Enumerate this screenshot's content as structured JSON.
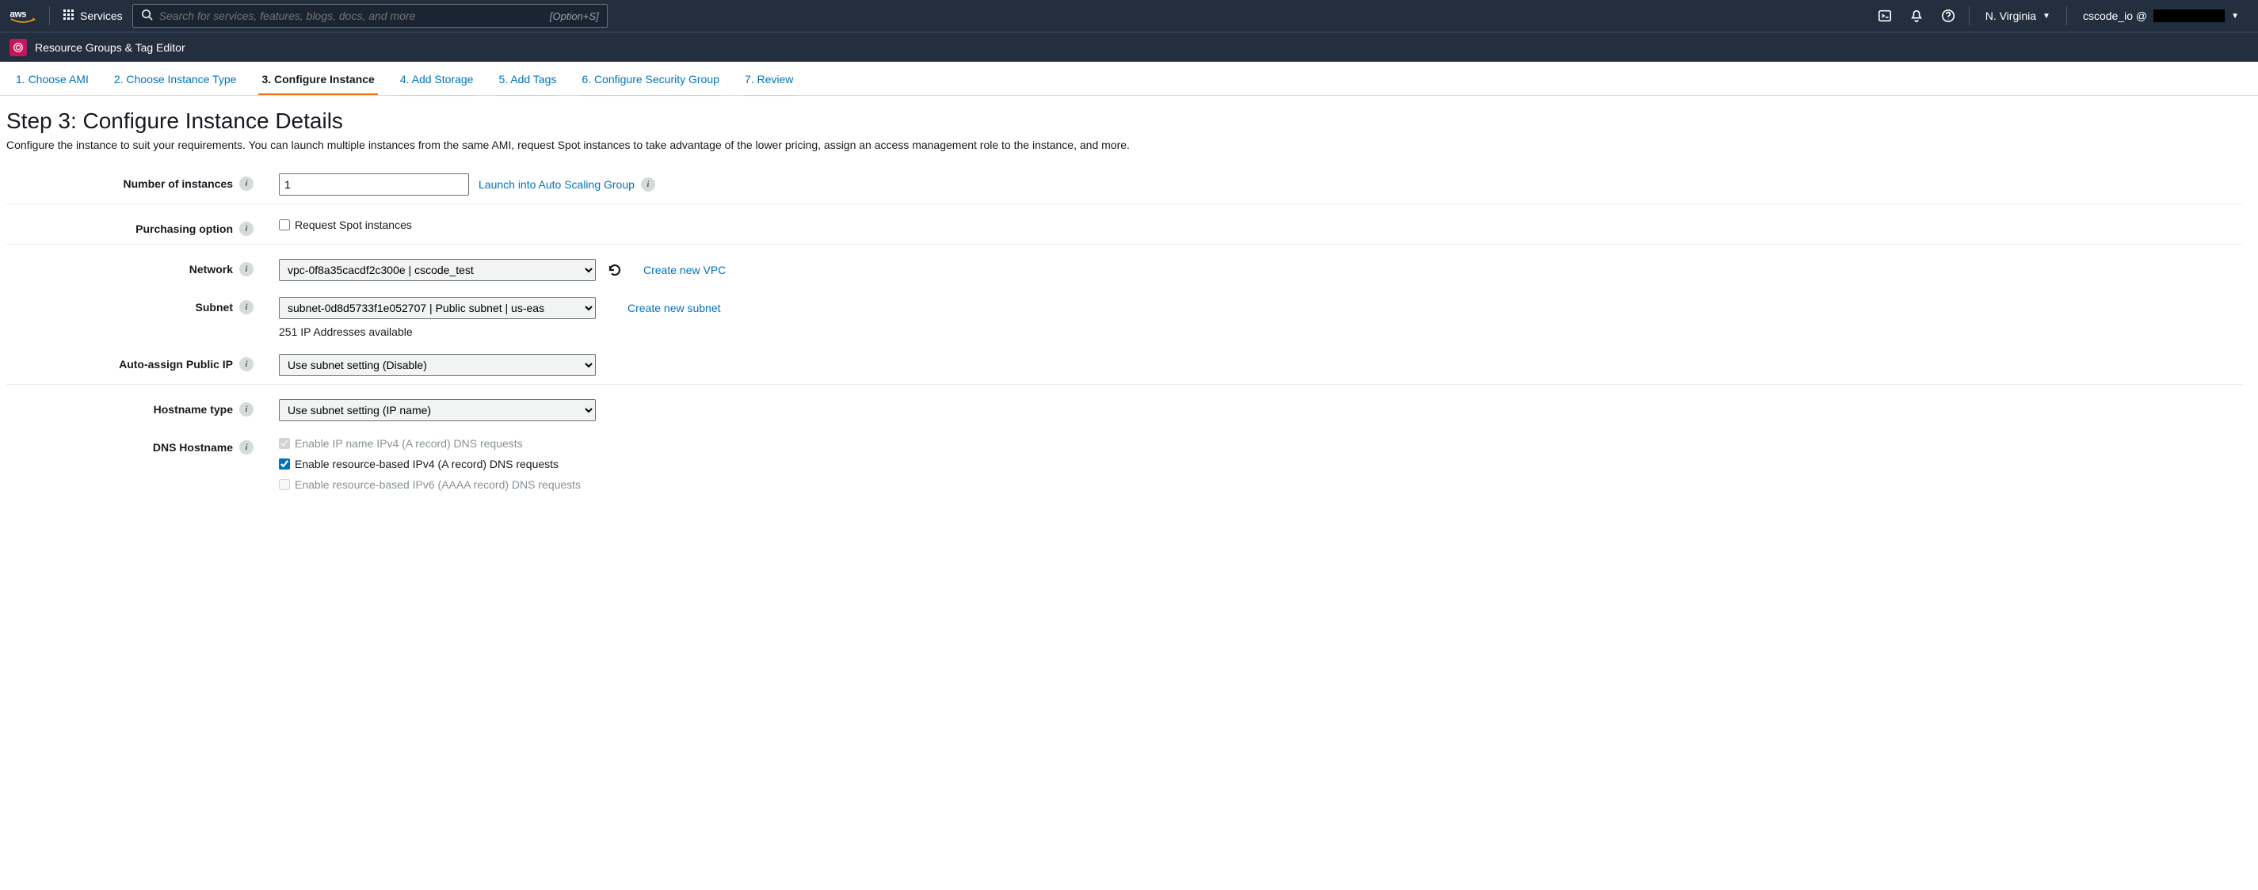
{
  "nav": {
    "services_label": "Services",
    "search_placeholder": "Search for services, features, blogs, docs, and more",
    "search_shortcut": "[Option+S]",
    "region": "N. Virginia",
    "account_prefix": "cscode_io @"
  },
  "subnav": {
    "label": "Resource Groups & Tag Editor"
  },
  "wizard": {
    "tabs": [
      "1. Choose AMI",
      "2. Choose Instance Type",
      "3. Configure Instance",
      "4. Add Storage",
      "5. Add Tags",
      "6. Configure Security Group",
      "7. Review"
    ],
    "active_index": 2
  },
  "page": {
    "title": "Step 3: Configure Instance Details",
    "description": "Configure the instance to suit your requirements. You can launch multiple instances from the same AMI, request Spot instances to take advantage of the lower pricing, assign an access management role to the instance, and more."
  },
  "form": {
    "num_instances": {
      "label": "Number of instances",
      "value": "1",
      "asg_link": "Launch into Auto Scaling Group"
    },
    "purchasing": {
      "label": "Purchasing option",
      "checkbox_label": "Request Spot instances",
      "checked": false
    },
    "network": {
      "label": "Network",
      "value": "vpc-0f8a35cacdf2c300e | cscode_test",
      "create_link": "Create new VPC"
    },
    "subnet": {
      "label": "Subnet",
      "value": "subnet-0d8d5733f1e052707 | Public subnet | us-eas",
      "available": "251 IP Addresses available",
      "create_link": "Create new subnet"
    },
    "auto_ip": {
      "label": "Auto-assign Public IP",
      "value": "Use subnet setting (Disable)"
    },
    "hostname": {
      "label": "Hostname type",
      "value": "Use subnet setting (IP name)"
    },
    "dns": {
      "label": "DNS Hostname",
      "options": [
        {
          "label": "Enable IP name IPv4 (A record) DNS requests",
          "checked": true,
          "disabled": true
        },
        {
          "label": "Enable resource-based IPv4 (A record) DNS requests",
          "checked": true,
          "disabled": false
        },
        {
          "label": "Enable resource-based IPv6 (AAAA record) DNS requests",
          "checked": false,
          "disabled": true
        }
      ]
    }
  }
}
